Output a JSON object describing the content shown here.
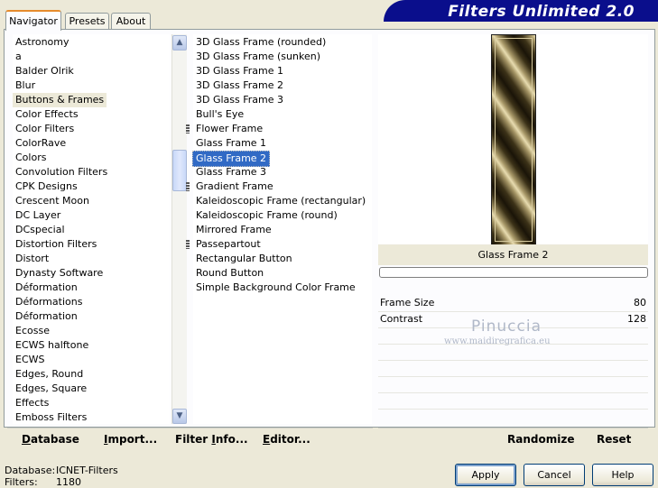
{
  "tabs": [
    {
      "label": "Navigator"
    },
    {
      "label": "Presets"
    },
    {
      "label": "About"
    }
  ],
  "header": {
    "title": "Filters Unlimited 2.0"
  },
  "categories": [
    "Astronomy",
    "a",
    "Balder Olrik",
    "Blur",
    "Buttons & Frames",
    "Color Effects",
    "Color Filters",
    "ColorRave",
    "Colors",
    "Convolution Filters",
    "CPK Designs",
    "Crescent Moon",
    "DC Layer",
    "DCspecial",
    "Distortion Filters",
    "Distort",
    "Dynasty Software",
    "Déformation",
    "Déformations",
    "Déformation",
    "Ecosse",
    "ECWS halftone",
    "ECWS",
    "Edges, Round",
    "Edges, Square",
    "Effects",
    "Emboss Filters"
  ],
  "selected_category": "Buttons & Frames",
  "filters": [
    {
      "label": "3D Glass Frame (rounded)",
      "marked": false
    },
    {
      "label": "3D Glass Frame (sunken)",
      "marked": false
    },
    {
      "label": "3D Glass Frame 1",
      "marked": false
    },
    {
      "label": "3D Glass Frame 2",
      "marked": false
    },
    {
      "label": "3D Glass Frame 3",
      "marked": false
    },
    {
      "label": "Bull's Eye",
      "marked": false
    },
    {
      "label": "Flower Frame",
      "marked": true
    },
    {
      "label": "Glass Frame 1",
      "marked": false
    },
    {
      "label": "Glass Frame 2",
      "marked": false
    },
    {
      "label": "Glass Frame 3",
      "marked": false
    },
    {
      "label": "Gradient Frame",
      "marked": true
    },
    {
      "label": "Kaleidoscopic Frame (rectangular)",
      "marked": false
    },
    {
      "label": "Kaleidoscopic Frame (round)",
      "marked": false
    },
    {
      "label": "Mirrored Frame",
      "marked": false
    },
    {
      "label": "Passepartout",
      "marked": true
    },
    {
      "label": "Rectangular Button",
      "marked": false
    },
    {
      "label": "Round Button",
      "marked": false
    },
    {
      "label": "Simple Background Color Frame",
      "marked": false
    }
  ],
  "selected_filter": "Glass Frame 2",
  "preview": {
    "filter_name": "Glass Frame 2"
  },
  "params": [
    {
      "label": "Frame Size",
      "value": "80"
    },
    {
      "label": "Contrast",
      "value": "128"
    }
  ],
  "watermark": {
    "name": "Pinuccia",
    "url": "www.maidiregrafica.eu"
  },
  "left_bar": {
    "database": {
      "u": "D",
      "rest": "atabase"
    },
    "import": {
      "u": "I",
      "rest": "mport..."
    },
    "filter_info": {
      "pre": "Filter ",
      "u": "I",
      "rest": "nfo..."
    },
    "editor": {
      "u": "E",
      "rest": "ditor..."
    }
  },
  "right_bar": {
    "randomize": "Randomize",
    "reset": "Reset"
  },
  "info": {
    "database_label": "Database:",
    "database_value": "ICNET-Filters",
    "filters_label": "Filters:",
    "filters_value": "1180"
  },
  "buttons": {
    "apply": "Apply",
    "cancel": "Cancel",
    "help": "Help"
  },
  "icons": {
    "scroll_up": "chevron-up-icon",
    "scroll_down": "chevron-down-icon"
  },
  "colors": {
    "banner": "#0a0e8c",
    "selection": "#316ac5",
    "tab_accent": "#e68b2c"
  }
}
